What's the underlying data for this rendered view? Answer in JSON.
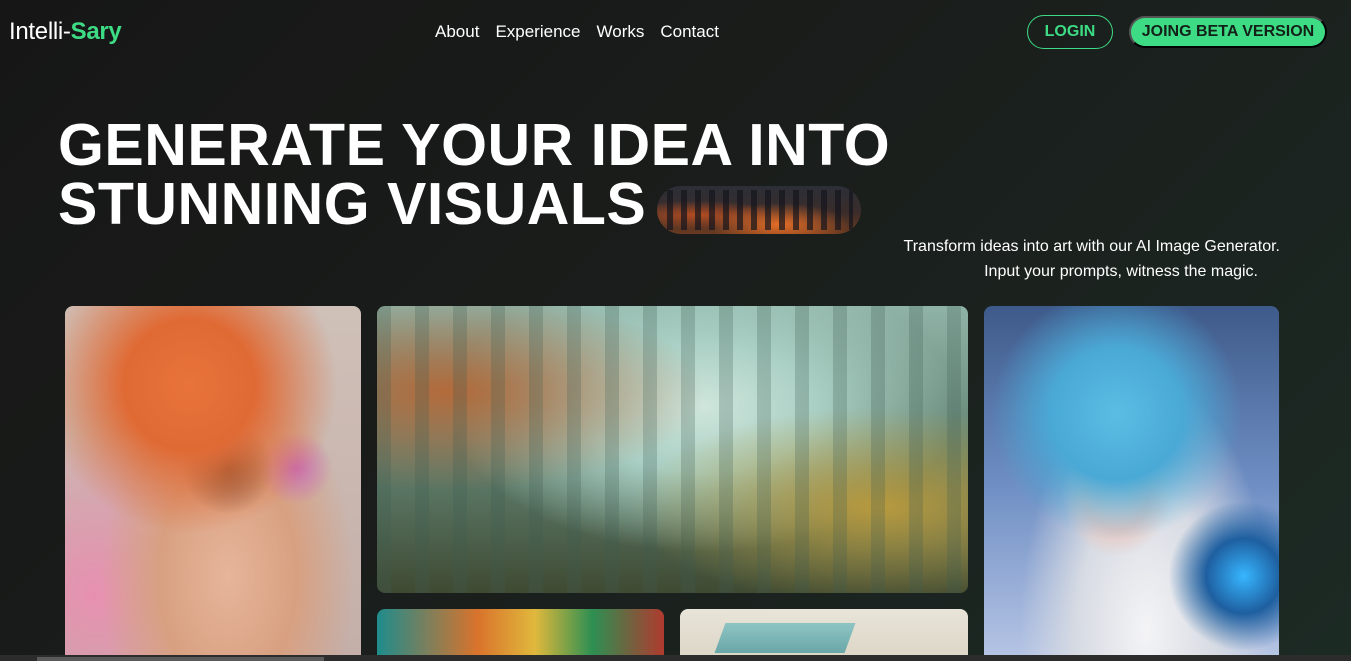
{
  "header": {
    "logo_prefix": "Intelli-",
    "logo_accent": "Sary",
    "nav": [
      "About",
      "Experience",
      "Works",
      "Contact"
    ],
    "login_label": "LOGIN",
    "beta_label": "JOING BETA VERSION"
  },
  "hero": {
    "title_line1": "GENERATE YOUR IDEA INTO",
    "title_line2": "STUNNING VISUALS",
    "subtitle_line1": "Transform ideas into art with our AI Image Generator.",
    "subtitle_line2": "Input your prompts, witness the magic."
  },
  "colors": {
    "accent": "#3ddc84",
    "background": "#161616"
  }
}
